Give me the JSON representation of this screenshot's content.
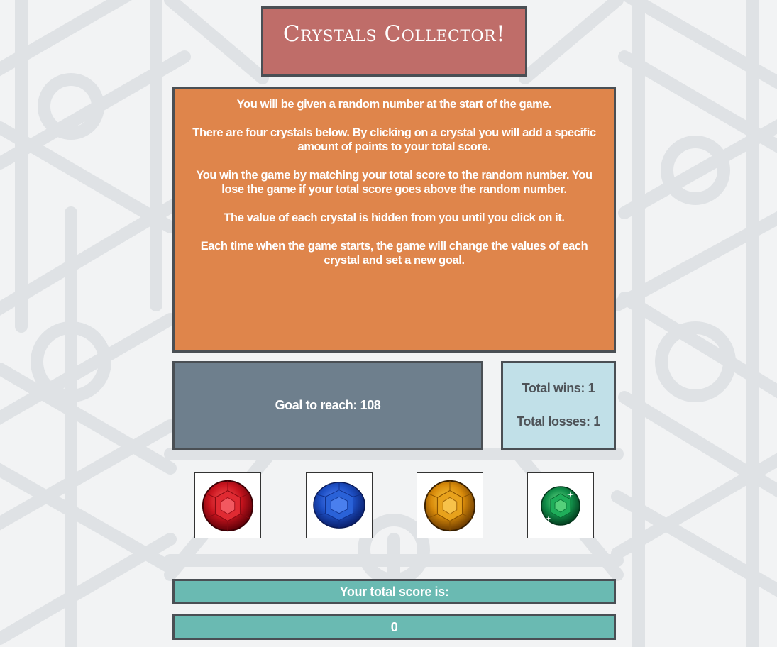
{
  "title": "Crystals Collector!",
  "instructions": [
    "You will be given a random number at the start of the game.",
    "There are four crystals below. By clicking on a crystal you will add a specific amount of points to your total score.",
    "You win the game by matching your total score to the random number. You lose the game if your total score goes above the random number.",
    "The value of each crystal is hidden from you until you click on it.",
    "Each time when the game starts, the game will change the values of each crystal and set a new goal."
  ],
  "goal": {
    "label": "Goal to reach:",
    "value": "108",
    "display": "Goal to reach: 108"
  },
  "stats": {
    "wins_label": "Total wins:",
    "wins": "1",
    "wins_display": "Total wins: 1",
    "losses_label": "Total losses:",
    "losses": "1",
    "losses_display": "Total losses: 1"
  },
  "crystals": [
    {
      "name": "red crystal",
      "color": "#c8141e"
    },
    {
      "name": "blue crystal",
      "color": "#1d4fc4"
    },
    {
      "name": "yellow crystal",
      "color": "#d88a0a"
    },
    {
      "name": "green crystal",
      "color": "#12904a"
    }
  ],
  "score": {
    "label": "Your total score is:",
    "value": "0"
  },
  "colors": {
    "title_bg": "#bf6d69",
    "instructions_bg": "#df854b",
    "goal_bg": "#6e7f8d",
    "stats_bg": "#c1e0e8",
    "score_bg": "#6abab2",
    "border": "#4a4f54"
  }
}
